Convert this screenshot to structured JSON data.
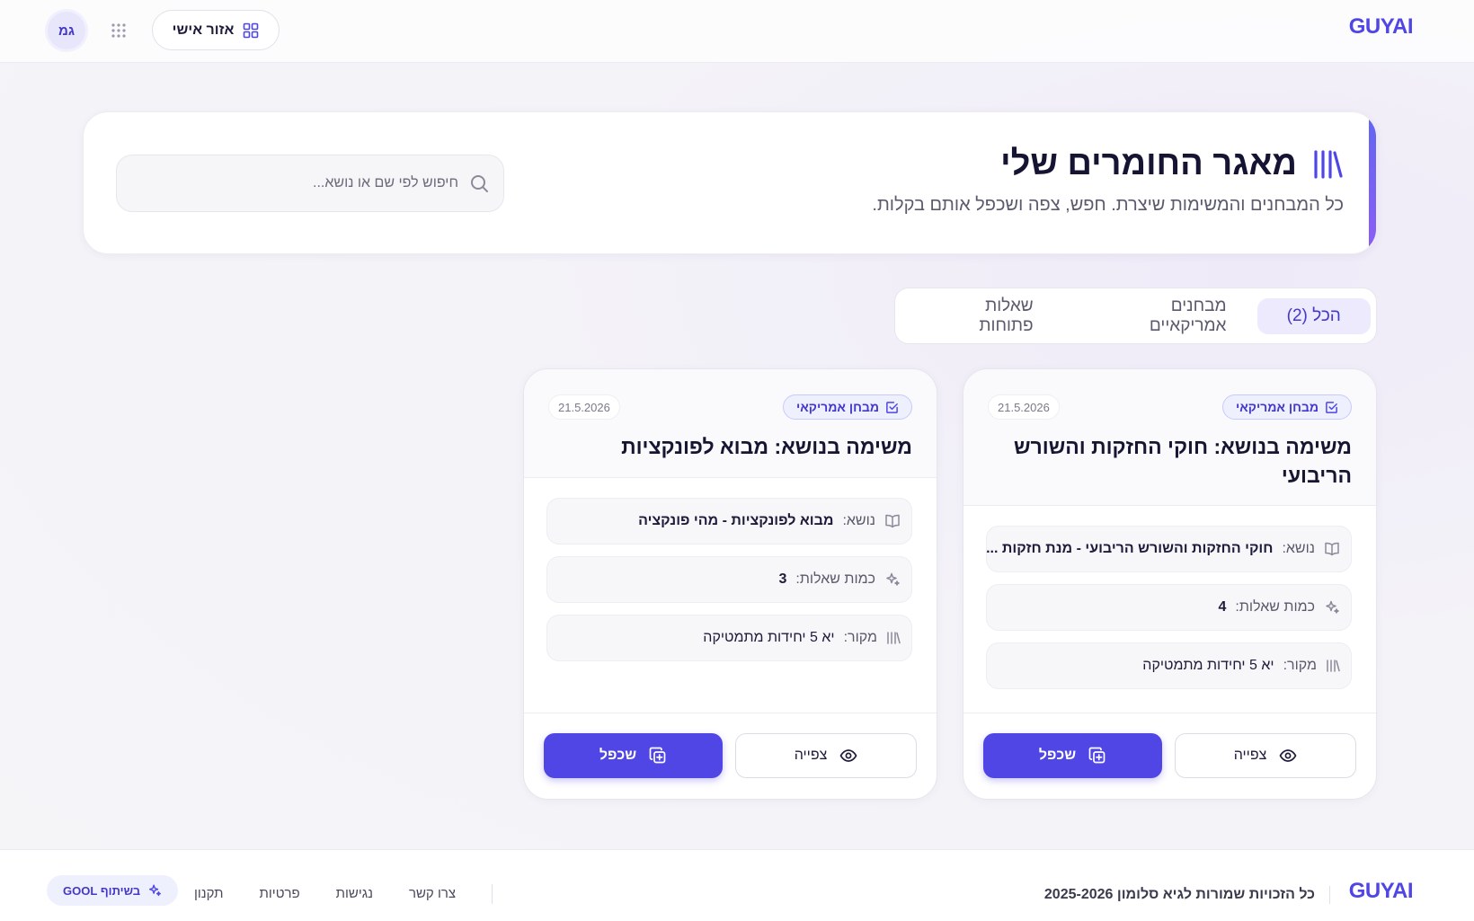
{
  "header": {
    "brand": "GUYAI",
    "avatar_initials": "גמ",
    "personal_area_label": "אזור אישי"
  },
  "hero": {
    "title": "מאגר החומרים שלי",
    "subtitle": "כל המבחנים והמשימות שיצרת. חפש, צפה ושכפל אותם בקלות.",
    "search_placeholder": "חיפוש לפי שם או נושא..."
  },
  "tabs": [
    {
      "label": "הכל (2)",
      "active": true
    },
    {
      "label": "מבחנים אמריקאיים",
      "active": false
    },
    {
      "label": "שאלות פתוחות",
      "active": false
    }
  ],
  "cards": [
    {
      "badge": "מבחן אמריקאי",
      "date": "21.5.2026",
      "title": "משימה בנושא: חוקי החזקות והשורש הריבועי",
      "topic_label": "נושא:",
      "topic_value": "חוקי החזקות והשורש הריבועי - מנת חזקות ...",
      "count_label": "כמות שאלות:",
      "count_value": "4",
      "source_label": "מקור:",
      "source_value": "יא 5 יחידות מתמטיקה",
      "view_label": "צפייה",
      "duplicate_label": "שכפל"
    },
    {
      "badge": "מבחן אמריקאי",
      "date": "21.5.2026",
      "title": "משימה בנושא: מבוא לפונקציות",
      "topic_label": "נושא:",
      "topic_value": "מבוא לפונקציות - מהי פונקציה",
      "count_label": "כמות שאלות:",
      "count_value": "3",
      "source_label": "מקור:",
      "source_value": "יא 5 יחידות מתמטיקה",
      "view_label": "צפייה",
      "duplicate_label": "שכפל"
    }
  ],
  "footer": {
    "brand": "GUYAI",
    "copyright": "כל הזכויות שמורות לגיא סלומון 2025-2026",
    "links": [
      "צרו קשר",
      "נגישות",
      "פרטיות",
      "תקנון"
    ],
    "partner_label": "בשיתוף GOOL"
  },
  "colors": {
    "accent": "#4f46e5",
    "accent_light": "#eef0fe",
    "text": "#1e1b3a"
  },
  "icons": [
    "grid-icon",
    "apps-icon",
    "library-icon",
    "search-icon",
    "check-square-icon",
    "book-icon",
    "sparkles-icon",
    "eye-icon",
    "copy-plus-icon"
  ]
}
